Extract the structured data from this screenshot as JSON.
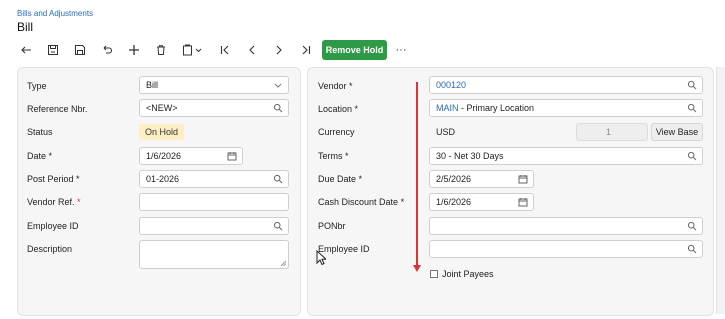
{
  "breadcrumb": "Bills and Adjustments",
  "page_title": "Bill",
  "toolbar": {
    "remove_hold_label": "Remove Hold",
    "more_label": "···"
  },
  "left": {
    "type_label": "Type",
    "type_value": "Bill",
    "ref_label": "Reference Nbr.",
    "ref_value": "<NEW>",
    "status_label": "Status",
    "status_value": "On Hold",
    "date_label": "Date",
    "date_value": "1/6/2026",
    "post_label": "Post Period",
    "post_value": "01-2026",
    "vendref_label": "Vendor Ref.",
    "vendref_value": "",
    "emp_label": "Employee ID",
    "emp_value": "",
    "desc_label": "Description",
    "desc_value": ""
  },
  "right": {
    "vendor_label": "Vendor",
    "vendor_value": "000120",
    "location_label": "Location",
    "location_code": "MAIN",
    "location_name": " - Primary Location",
    "currency_label": "Currency",
    "currency_value": "USD",
    "rate_value": "1",
    "view_base_label": "View Base",
    "terms_label": "Terms",
    "terms_value": "30 - Net 30 Days",
    "due_label": "Due Date",
    "due_value": "2/5/2026",
    "cash_label": "Cash Discount Date",
    "cash_value": "1/6/2026",
    "ponbr_label": "PONbr",
    "ponbr_value": "",
    "emp2_label": "Employee ID",
    "emp2_value": "",
    "joint_label": "Joint Payees"
  },
  "required_mark": "*",
  "colors": {
    "link": "#2a6bb8",
    "primary_button": "#2f9a46",
    "status_badge": "#fcefc4",
    "required": "#d23a3a",
    "annotation_arrow": "#d9343a"
  }
}
